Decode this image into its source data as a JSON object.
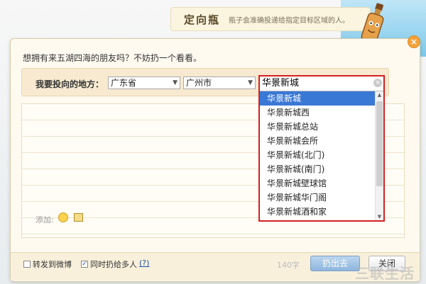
{
  "header": {
    "title": "定向瓶",
    "description": "瓶子会准确投递给指定目标区域的人。"
  },
  "dialog": {
    "question": "想拥有来五湖四海的朋友吗？不妨扔一个看看。",
    "destination_label": "我要投向的地方：",
    "province": "广东省",
    "city": "广州市",
    "search_value": "华景新城",
    "suggestions": [
      "华景新城",
      "华景新城西",
      "华景新城总站",
      "华景新城会所",
      "华景新城(北门)",
      "华景新城(南门)",
      "华景新城壁球馆",
      "华景新城华门阁",
      "华景新城酒和家"
    ],
    "selected_index": 0,
    "add_label": "添加:",
    "close_symbol": "×"
  },
  "footer": {
    "repost_weibo": "转发到微博",
    "throw_to_many": "同时扔给多人",
    "help": "(?)",
    "char_count": "140字",
    "throw_button": "扔出去",
    "close_button": "关闭"
  },
  "watermark": "三联生活",
  "colors": {
    "accent_blue": "#3a78d6",
    "highlight_red": "#d42020",
    "close_orange": "#f5a23a"
  }
}
